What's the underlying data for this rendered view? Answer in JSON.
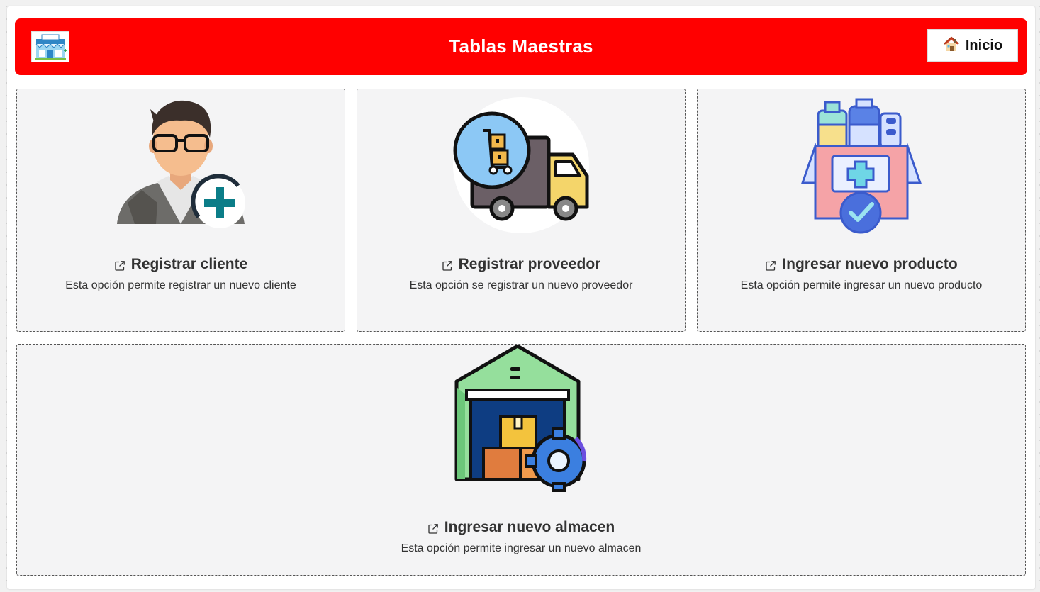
{
  "header": {
    "title": "Tablas Maestras",
    "home_label": "Inicio",
    "logo_icon": "pharmacy-store-icon",
    "home_icon": "house-icon",
    "background_color": "#ff0000"
  },
  "cards": [
    {
      "title": "Registrar cliente",
      "description": "Esta opción permite registrar un nuevo cliente",
      "icon": "add-customer-icon"
    },
    {
      "title": "Registrar proveedor",
      "description": "Esta opción se registrar un nuevo proveedor",
      "icon": "delivery-truck-icon"
    },
    {
      "title": "Ingresar nuevo producto",
      "description": "Esta opción permite ingresar un nuevo producto",
      "icon": "medical-box-icon"
    },
    {
      "title": "Ingresar nuevo almacen",
      "description": "Esta opción permite ingresar un nuevo almacen",
      "icon": "warehouse-settings-icon"
    }
  ]
}
